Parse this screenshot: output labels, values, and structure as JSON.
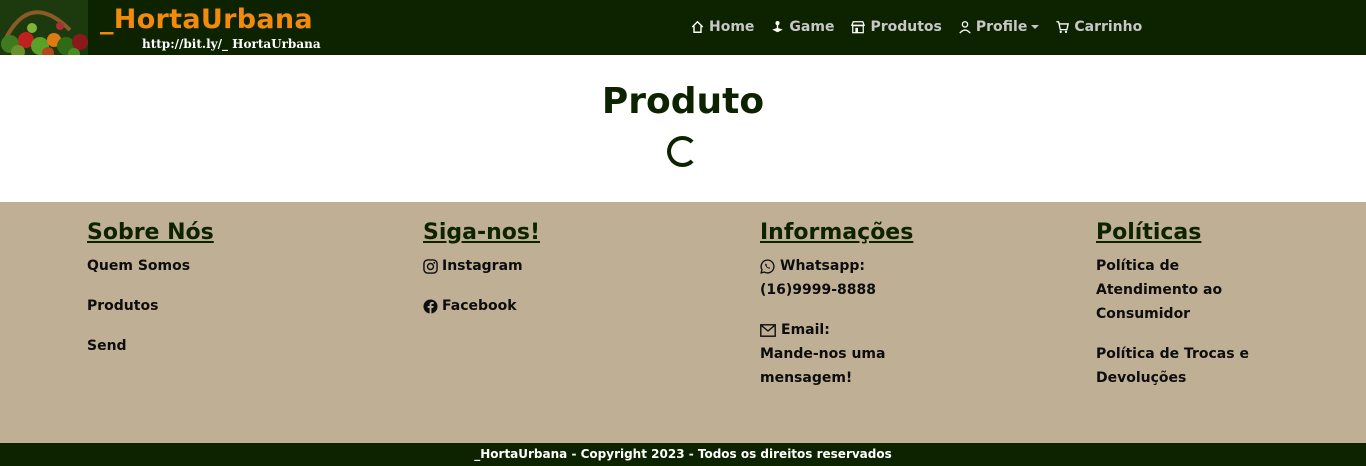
{
  "header": {
    "brand": "_HortaUrbana",
    "brand_url": "http://bit.ly/_ HortaUrbana",
    "nav": [
      {
        "label": "Home",
        "icon": "home-icon"
      },
      {
        "label": "Game",
        "icon": "joystick-icon"
      },
      {
        "label": "Produtos",
        "icon": "shop-icon"
      },
      {
        "label": "Profile",
        "icon": "person-icon"
      },
      {
        "label": "Carrinho",
        "icon": "cart-icon"
      }
    ]
  },
  "main": {
    "title": "Produto"
  },
  "footer": {
    "sobre": {
      "title": "Sobre Nós",
      "links": [
        "Quem Somos",
        "Produtos",
        "Send"
      ]
    },
    "siga": {
      "title": "Siga-nos!",
      "links": [
        "Instagram",
        "Facebook"
      ]
    },
    "info": {
      "title": "Informações",
      "whatsapp_label": "Whatsapp:",
      "whatsapp_number": "(16)9999-8888",
      "email_label": "Email:",
      "email_line1": "Mande-nos uma",
      "email_line2": "mensagem!"
    },
    "politicas": {
      "title": "Políticas",
      "p1_line1": "Política de",
      "p1_line2": "Atendimento ao",
      "p1_line3": "Consumidor",
      "p2_line1": "Política de Trocas e",
      "p2_line2": "Devoluções"
    }
  },
  "copyright": "_HortaUrbana - Copyright 2023 - Todos os direitos reservados",
  "colors": {
    "dark_green": "#0d2300",
    "orange": "#f28a0c",
    "beige": "#bfb095"
  }
}
